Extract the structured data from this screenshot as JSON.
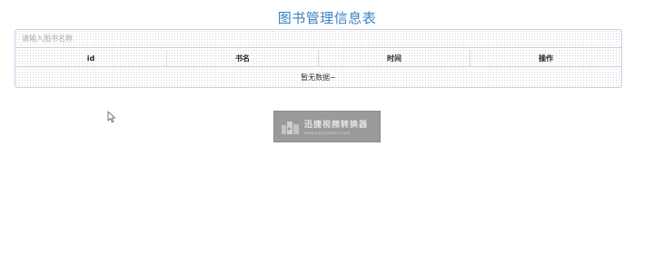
{
  "page": {
    "title": "图书管理信息表"
  },
  "search": {
    "placeholder": "请输入图书名称",
    "value": ""
  },
  "table": {
    "columns": [
      "id",
      "书名",
      "时间",
      "操作"
    ],
    "rows": [],
    "empty_text": "暂无数据~"
  },
  "watermark": {
    "name": "迅捷视频转换器",
    "url": "www.xunjieshipin.com"
  },
  "colors": {
    "title": "#3a82c4",
    "border": "#c6cfe6",
    "watermark_bg": "#9a9a9a"
  },
  "icons": {
    "cursor": "mouse-pointer-icon",
    "watermark_logo": "watermark-logo-icon"
  }
}
